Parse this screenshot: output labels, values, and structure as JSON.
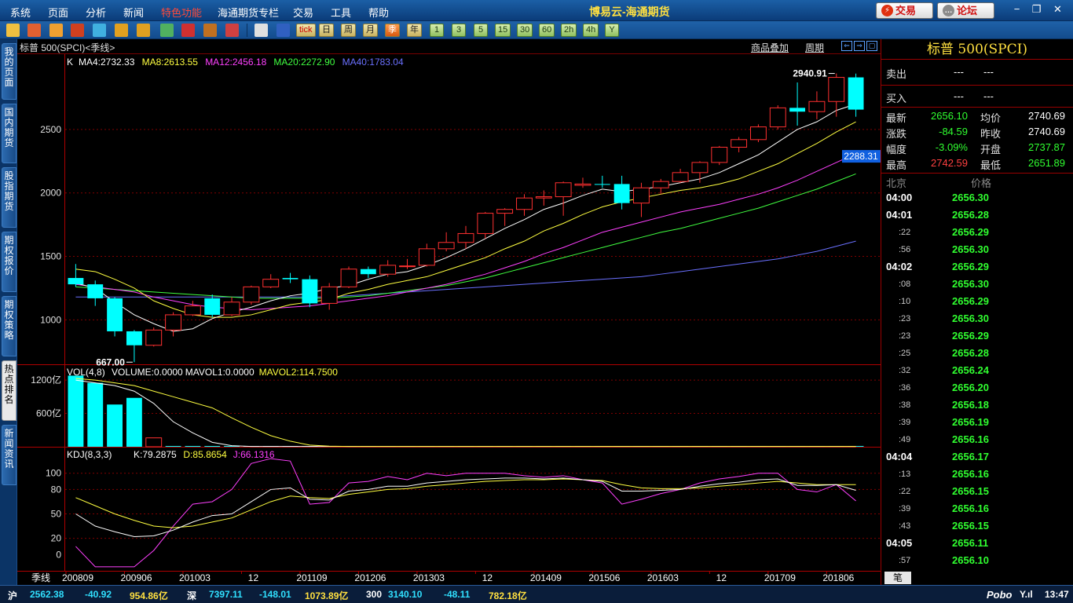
{
  "menu": {
    "items": [
      "系统",
      "页面",
      "分析",
      "新闻",
      "特色功能",
      "海通期货专栏",
      "交易",
      "工具",
      "帮助"
    ],
    "special_index": 4,
    "title": "博易云-海通期货",
    "trade_btn": "交易",
    "forum_btn": "论坛"
  },
  "toolbar": {
    "period_buttons": [
      "日",
      "周",
      "月",
      "季",
      "年"
    ],
    "active_period": "季",
    "minute_buttons": [
      "1",
      "3",
      "5",
      "15",
      "30",
      "60",
      "2h",
      "4h",
      "Y"
    ],
    "tick_label": "tick"
  },
  "left_tabs": [
    "我的页面",
    "国内期货",
    "股指期货",
    "期权报价",
    "期权策略",
    "热点排名",
    "新闻资讯"
  ],
  "left_tab_active": 5,
  "chart": {
    "title": "标普 500(SPCI)<季线>",
    "link_overlay": "商品叠加",
    "link_period": "周期",
    "ma_prefix": "K",
    "ma_items": [
      {
        "text": "MA4:2732.33",
        "color": "#ffffff"
      },
      {
        "text": "MA8:2613.55",
        "color": "#ffff40"
      },
      {
        "text": "MA12:2456.18",
        "color": "#ff40ff"
      },
      {
        "text": "MA20:2272.90",
        "color": "#40ff40"
      },
      {
        "text": "MA40:1783.04",
        "color": "#6a70ff"
      }
    ],
    "y_ticks": [
      "2500",
      "2000",
      "1500",
      "1000"
    ],
    "price_tag": "2288.31",
    "high_label": "2940.91",
    "low_label": "667.00",
    "vol_title": "VOL(4,8)",
    "vol_items": [
      {
        "text": "VOLUME:0.0000",
        "color": "#ffffff"
      },
      {
        "text": "MAVOL1:0.0000",
        "color": "#ffffff"
      },
      {
        "text": "MAVOL2:114.7500",
        "color": "#ffff40"
      }
    ],
    "vol_ticks": [
      "1200亿",
      "600亿"
    ],
    "kdj_title": "KDJ(8,3,3)",
    "kdj_items": [
      {
        "text": "K:79.2875",
        "color": "#ffffff"
      },
      {
        "text": "D:85.8654",
        "color": "#ffff40"
      },
      {
        "text": "J:66.1316",
        "color": "#ff40ff"
      }
    ],
    "kdj_ticks": [
      "100",
      "80",
      "50",
      "20",
      "0"
    ],
    "x_label": "季线",
    "x_ticks": [
      "200809",
      "200906",
      "201003",
      "12",
      "201109",
      "201206",
      "201303",
      "12",
      "201409",
      "201506",
      "201603",
      "12",
      "201709",
      "201806"
    ]
  },
  "chart_data": {
    "type": "candlestick",
    "title": "标普 500(SPCI)<季线>",
    "candles": [
      {
        "o": 1330,
        "c": 1280,
        "h": 1440,
        "l": 1260
      },
      {
        "o": 1280,
        "c": 1170,
        "h": 1310,
        "l": 1110
      },
      {
        "o": 1170,
        "c": 910,
        "h": 1180,
        "l": 870
      },
      {
        "o": 910,
        "c": 800,
        "h": 920,
        "l": 667
      },
      {
        "o": 800,
        "c": 920,
        "h": 940,
        "l": 790
      },
      {
        "o": 920,
        "c": 1040,
        "h": 1060,
        "l": 870
      },
      {
        "o": 1040,
        "c": 1110,
        "h": 1150,
        "l": 1030
      },
      {
        "o": 1170,
        "c": 1040,
        "h": 1200,
        "l": 1020
      },
      {
        "o": 1040,
        "c": 1140,
        "h": 1180,
        "l": 1030
      },
      {
        "o": 1140,
        "c": 1260,
        "h": 1270,
        "l": 1120
      },
      {
        "o": 1260,
        "c": 1320,
        "h": 1360,
        "l": 1250
      },
      {
        "o": 1330,
        "c": 1320,
        "h": 1370,
        "l": 1290
      },
      {
        "o": 1320,
        "c": 1130,
        "h": 1350,
        "l": 1100
      },
      {
        "o": 1130,
        "c": 1260,
        "h": 1290,
        "l": 1080
      },
      {
        "o": 1260,
        "c": 1400,
        "h": 1420,
        "l": 1250
      },
      {
        "o": 1400,
        "c": 1360,
        "h": 1420,
        "l": 1330
      },
      {
        "o": 1360,
        "c": 1430,
        "h": 1470,
        "l": 1340
      },
      {
        "o": 1420,
        "c": 1425,
        "h": 1480,
        "l": 1400
      },
      {
        "o": 1430,
        "c": 1560,
        "h": 1600,
        "l": 1420
      },
      {
        "o": 1560,
        "c": 1610,
        "h": 1690,
        "l": 1540
      },
      {
        "o": 1610,
        "c": 1680,
        "h": 1740,
        "l": 1560
      },
      {
        "o": 1680,
        "c": 1840,
        "h": 1850,
        "l": 1640
      },
      {
        "o": 1840,
        "c": 1870,
        "h": 1880,
        "l": 1740
      },
      {
        "o": 1870,
        "c": 1960,
        "h": 1990,
        "l": 1820
      },
      {
        "o": 1960,
        "c": 1970,
        "h": 2020,
        "l": 1900
      },
      {
        "o": 1970,
        "c": 2080,
        "h": 2090,
        "l": 1820
      },
      {
        "o": 2060,
        "c": 2070,
        "h": 2120,
        "l": 2040
      },
      {
        "o": 2070,
        "c": 2065,
        "h": 2135,
        "l": 2040
      },
      {
        "o": 2070,
        "c": 1920,
        "h": 2135,
        "l": 1870
      },
      {
        "o": 1920,
        "c": 2040,
        "h": 2080,
        "l": 1810
      },
      {
        "o": 2040,
        "c": 2090,
        "h": 2110,
        "l": 1990
      },
      {
        "o": 2090,
        "c": 2160,
        "h": 2190,
        "l": 2080
      },
      {
        "o": 2160,
        "c": 2240,
        "h": 2250,
        "l": 2080
      },
      {
        "o": 2240,
        "c": 2360,
        "h": 2370,
        "l": 2220
      },
      {
        "o": 2360,
        "c": 2420,
        "h": 2440,
        "l": 2320
      },
      {
        "o": 2420,
        "c": 2520,
        "h": 2540,
        "l": 2400
      },
      {
        "o": 2520,
        "c": 2670,
        "h": 2690,
        "l": 2500
      },
      {
        "o": 2670,
        "c": 2640,
        "h": 2870,
        "l": 2530
      },
      {
        "o": 2640,
        "c": 2720,
        "h": 2800,
        "l": 2580
      },
      {
        "o": 2720,
        "c": 2910,
        "h": 2940.91,
        "l": 2600
      },
      {
        "o": 2910,
        "c": 2656.1,
        "h": 2940,
        "l": 2600
      }
    ],
    "ma4": [
      1290,
      1250,
      1140,
      1040,
      970,
      910,
      930,
      1010,
      1060,
      1100,
      1150,
      1190,
      1210,
      1250,
      1270,
      1320,
      1360,
      1380,
      1430,
      1490,
      1560,
      1640,
      1720,
      1790,
      1870,
      1920,
      1980,
      2030,
      2010,
      2030,
      2050,
      2080,
      2110,
      2160,
      2230,
      2300,
      2400,
      2500,
      2560,
      2650,
      2700
    ],
    "ma8": [
      1400,
      1380,
      1320,
      1250,
      1150,
      1090,
      1040,
      1020,
      1020,
      1040,
      1080,
      1120,
      1140,
      1160,
      1210,
      1240,
      1280,
      1310,
      1340,
      1390,
      1440,
      1490,
      1560,
      1620,
      1700,
      1760,
      1830,
      1890,
      1930,
      1960,
      1990,
      2020,
      2040,
      2070,
      2110,
      2170,
      2230,
      2310,
      2390,
      2480,
      2560
    ],
    "ma12": [
      1280,
      1260,
      1240,
      1220,
      1180,
      1150,
      1120,
      1100,
      1090,
      1080,
      1090,
      1100,
      1110,
      1130,
      1150,
      1170,
      1190,
      1220,
      1250,
      1280,
      1320,
      1360,
      1410,
      1460,
      1520,
      1570,
      1630,
      1690,
      1730,
      1770,
      1810,
      1850,
      1880,
      1910,
      1950,
      1990,
      2040,
      2100,
      2170,
      2240,
      2310
    ],
    "ma20": [
      1260,
      1250,
      1240,
      1230,
      1220,
      1210,
      1200,
      1190,
      1180,
      1170,
      1170,
      1170,
      1170,
      1170,
      1180,
      1190,
      1210,
      1230,
      1250,
      1270,
      1300,
      1330,
      1370,
      1410,
      1450,
      1490,
      1530,
      1570,
      1610,
      1650,
      1690,
      1720,
      1760,
      1800,
      1840,
      1880,
      1930,
      1980,
      2030,
      2090,
      2150
    ],
    "ma40": [
      1180,
      1180,
      1180,
      1180,
      1180,
      1180,
      1180,
      1180,
      1180,
      1180,
      1180,
      1180,
      1180,
      1180,
      1190,
      1200,
      1210,
      1220,
      1230,
      1240,
      1250,
      1260,
      1270,
      1280,
      1290,
      1300,
      1310,
      1320,
      1330,
      1340,
      1360,
      1380,
      1400,
      1420,
      1440,
      1460,
      1480,
      1510,
      1540,
      1580,
      1620
    ],
    "volume": [
      1280,
      1150,
      760,
      880,
      160,
      5,
      5,
      5,
      5,
      5,
      5,
      5,
      5,
      5,
      5,
      5,
      5,
      5,
      5,
      5,
      5,
      5,
      5,
      5,
      5,
      5,
      5,
      5,
      5,
      5,
      5,
      5,
      5,
      5,
      5,
      5,
      5,
      5,
      5,
      5,
      5
    ],
    "mavol1": [
      1200,
      1150,
      1100,
      1000,
      780,
      450,
      250,
      80,
      20,
      5,
      5,
      5,
      5,
      5,
      5,
      5,
      5,
      5,
      5,
      5,
      5,
      5,
      5,
      5,
      5,
      5,
      5,
      5,
      5,
      5,
      5,
      5,
      5,
      5,
      5,
      5,
      5,
      5,
      5,
      5,
      5
    ],
    "mavol2": [
      1230,
      1200,
      1150,
      1100,
      1000,
      900,
      800,
      700,
      520,
      350,
      200,
      100,
      30,
      10,
      5,
      5,
      5,
      5,
      5,
      5,
      5,
      5,
      5,
      5,
      5,
      5,
      5,
      5,
      5,
      5,
      5,
      5,
      5,
      5,
      5,
      5,
      5,
      5,
      5,
      5,
      5
    ],
    "kdj_k": [
      50,
      35,
      28,
      22,
      23,
      30,
      40,
      48,
      50,
      65,
      80,
      82,
      68,
      67,
      78,
      80,
      84,
      84,
      88,
      90,
      92,
      93,
      94,
      94,
      93,
      94,
      92,
      90,
      78,
      78,
      79,
      80,
      84,
      87,
      89,
      92,
      93,
      85,
      85,
      86,
      79
    ],
    "kdj_d": [
      70,
      60,
      50,
      42,
      35,
      33,
      35,
      40,
      45,
      55,
      65,
      72,
      70,
      69,
      74,
      77,
      80,
      81,
      84,
      86,
      88,
      90,
      91,
      92,
      92,
      93,
      92,
      91,
      86,
      82,
      81,
      81,
      82,
      84,
      86,
      88,
      90,
      88,
      86,
      86,
      86
    ],
    "kdj_j": [
      10,
      -15,
      -15,
      -15,
      5,
      35,
      62,
      65,
      80,
      112,
      118,
      115,
      62,
      64,
      88,
      90,
      96,
      92,
      100,
      97,
      100,
      100,
      100,
      97,
      95,
      97,
      92,
      88,
      62,
      68,
      75,
      80,
      88,
      93,
      96,
      100,
      100,
      80,
      77,
      86,
      66
    ],
    "ylim": [
      650,
      3000
    ],
    "vol_ylim": [
      0,
      1300
    ],
    "kdj_ylim": [
      -20,
      120
    ]
  },
  "right_panel": {
    "title": "标普 500(SPCI)",
    "sell_label": "卖出",
    "buy_label": "买入",
    "placeholder": "---",
    "quote": [
      {
        "l1": "最新",
        "v1": "2656.10",
        "c1": "green",
        "l2": "均价",
        "v2": "2740.69",
        "c2": "white"
      },
      {
        "l1": "涨跌",
        "v1": "-84.59",
        "c1": "green",
        "l2": "昨收",
        "v2": "2740.69",
        "c2": "white"
      },
      {
        "l1": "幅度",
        "v1": "-3.09%",
        "c1": "green",
        "l2": "开盘",
        "v2": "2737.87",
        "c2": "green"
      },
      {
        "l1": "最高",
        "v1": "2742.59",
        "c1": "red",
        "l2": "最低",
        "v2": "2651.89",
        "c2": "green"
      }
    ],
    "tick_hdr_time": "北京",
    "tick_hdr_price": "价格",
    "ticks": [
      {
        "t": "04:00",
        "major": true,
        "p": "2656.30"
      },
      {
        "t": "04:01",
        "major": true,
        "p": "2656.28"
      },
      {
        "t": ":22",
        "major": false,
        "p": "2656.29"
      },
      {
        "t": ":56",
        "major": false,
        "p": "2656.30"
      },
      {
        "t": "04:02",
        "major": true,
        "p": "2656.29"
      },
      {
        "t": ":08",
        "major": false,
        "p": "2656.30"
      },
      {
        "t": ":10",
        "major": false,
        "p": "2656.29"
      },
      {
        "t": ":23",
        "major": false,
        "p": "2656.30"
      },
      {
        "t": ":23",
        "major": false,
        "p": "2656.29"
      },
      {
        "t": ":25",
        "major": false,
        "p": "2656.28"
      },
      {
        "t": ":32",
        "major": false,
        "p": "2656.24"
      },
      {
        "t": ":36",
        "major": false,
        "p": "2656.20"
      },
      {
        "t": ":38",
        "major": false,
        "p": "2656.18"
      },
      {
        "t": ":39",
        "major": false,
        "p": "2656.19"
      },
      {
        "t": ":49",
        "major": false,
        "p": "2656.16"
      },
      {
        "t": "04:04",
        "major": true,
        "p": "2656.17"
      },
      {
        "t": ":13",
        "major": false,
        "p": "2656.16"
      },
      {
        "t": ":22",
        "major": false,
        "p": "2656.15"
      },
      {
        "t": ":39",
        "major": false,
        "p": "2656.16"
      },
      {
        "t": ":43",
        "major": false,
        "p": "2656.15"
      },
      {
        "t": "04:05",
        "major": true,
        "p": "2656.11"
      },
      {
        "t": ":57",
        "major": false,
        "p": "2656.10"
      }
    ],
    "bottom_tab": "笔"
  },
  "status": {
    "sh_label": "沪",
    "sh_price": "2562.38",
    "sh_chg": "-40.92",
    "sh_amt": "954.86亿",
    "sz_label": "深",
    "sz_price": "7397.11",
    "sz_chg": "-148.01",
    "sz_amt": "1073.89亿",
    "c300_label": "300",
    "c300_price": "3140.10",
    "c300_chg": "-48.11",
    "c300_amt": "782.18亿",
    "brand": "Pobo",
    "time": "13:47"
  },
  "colors": {
    "up": "#ff3030",
    "down": "#00ffff",
    "grid": "#800000",
    "ma4": "#ffffff",
    "ma8": "#ffff40",
    "ma12": "#ff40ff",
    "ma20": "#40ff40",
    "ma40": "#6a70ff"
  }
}
